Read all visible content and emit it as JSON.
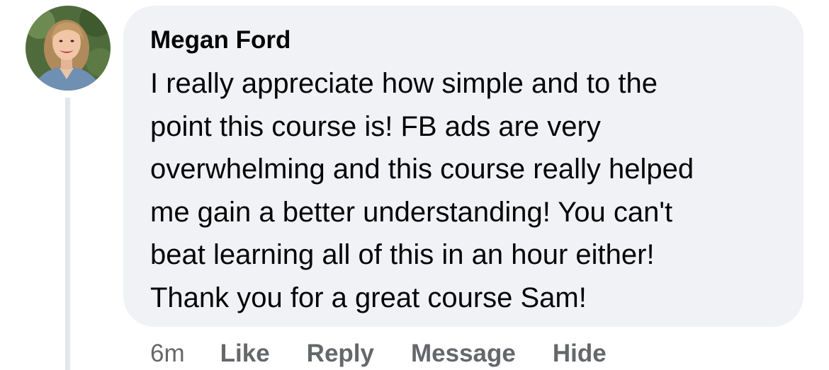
{
  "comment": {
    "author": "Megan Ford",
    "text": "I really appreciate how simple and to the\npoint this course is! FB ads are very\noverwhelming and this course really helped\nme gain a better understanding! You can't\nbeat learning all of this in an hour either!\nThank you for a great course Sam!",
    "timestamp": "6m",
    "actions": {
      "like": "Like",
      "reply": "Reply",
      "message": "Message",
      "hide": "Hide"
    }
  },
  "colors": {
    "bubble_bg": "#f0f2f5",
    "text_primary": "#050505",
    "text_secondary": "#65676b",
    "thread_line": "#e4e6eb"
  },
  "icons": {
    "avatar": "user-profile-photo"
  }
}
